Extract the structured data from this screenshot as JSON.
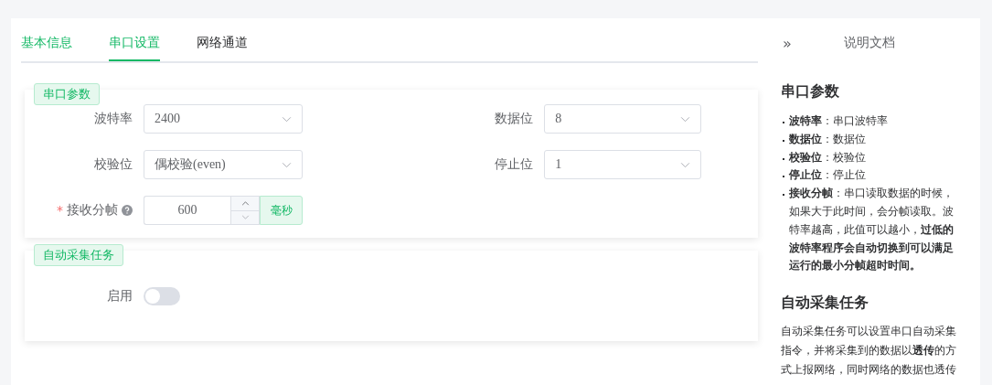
{
  "tabs": [
    {
      "label": "基本信息",
      "selected": false,
      "completed": true
    },
    {
      "label": "串口设置",
      "selected": true,
      "completed": false
    },
    {
      "label": "网络通道",
      "selected": false,
      "completed": false
    }
  ],
  "sections": [
    {
      "title": "串口参数",
      "fields": [
        {
          "kind": "select",
          "label": "波特率",
          "value": "2400"
        },
        {
          "kind": "select",
          "label": "数据位",
          "value": "8"
        },
        {
          "kind": "select",
          "label": "校验位",
          "value": "偶校验(even)"
        },
        {
          "kind": "select",
          "label": "停止位",
          "value": "1"
        },
        {
          "kind": "number",
          "label": "接收分帧",
          "value": "600",
          "unit": "毫秒",
          "required_mark": "*",
          "help": true
        }
      ]
    },
    {
      "title": "自动采集任务",
      "fields": [
        {
          "kind": "switch",
          "label": "启用",
          "on": false
        }
      ]
    }
  ],
  "docs": {
    "collapse": "»",
    "title": "说明文档",
    "sections": [
      {
        "heading": "串口参数",
        "items": [
          "**波特率**：串口波特率",
          "**数据位**：数据位",
          "**校验位**：校验位",
          "**停止位**：停止位",
          "**接收分帧**：串口读取数据的时候，如果大于此时间，会分帧读取。波特率越高，此值可以越小，**过低的波特率程序会自动切换到可以满足运行的最小分帧超时时间。**"
        ]
      },
      {
        "heading": "自动采集任务",
        "paragraph": "自动采集任务可以设置串口自动采集指令，并将采集到的数据以**透传**的方式上报网络，同时网络的数据也透传"
      }
    ]
  }
}
